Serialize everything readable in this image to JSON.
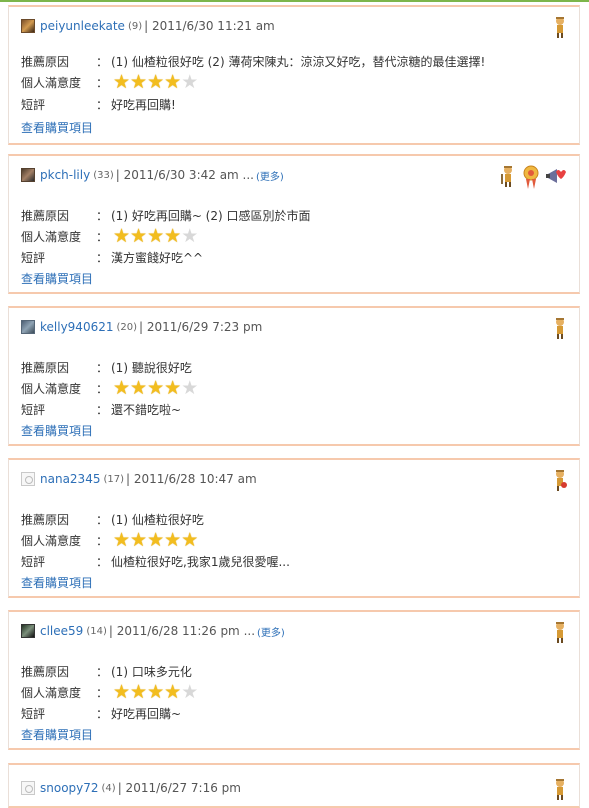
{
  "labels": {
    "reason": "推薦原因",
    "satisfaction": "個人滿意度",
    "comment": "短評",
    "colon": "："
  },
  "reviews": [
    {
      "user": "peiyunleekate",
      "count": "(9)",
      "date": "| 2011/6/30  11:21 am",
      "more": "",
      "reason": "(1) 仙楂粒很好吃  (2) 薄荷宋陳丸：涼涼又好吃，替代涼糖的最佳選擇!",
      "rating": 4,
      "comment": "好吃再回購!",
      "link": "查看購買項目",
      "avatar": "photo-avatar-icon",
      "medals": [
        "explorer-medal-icon"
      ]
    },
    {
      "user": "pkch-lily",
      "count": "(33)",
      "date": "| 2011/6/30  3:42 am ...",
      "more": "(更多)",
      "reason": "(1) 好吃再回購~  (2) 口感區別於市面",
      "rating": 4,
      "comment": "漢方蜜餞好吃^^",
      "link": "查看購買項目",
      "avatar": "photo-avatar-icon",
      "medals": [
        "explorer-medal-icon",
        "ribbon-medal-icon",
        "megaphone-heart-icon"
      ]
    },
    {
      "user": "kelly940621",
      "count": "(20)",
      "date": "| 2011/6/29  7:23 pm",
      "more": "",
      "reason": "(1) 聽說很好吃",
      "rating": 4,
      "comment": "還不錯吃啦~",
      "link": "查看購買項目",
      "avatar": "photo-avatar-icon",
      "medals": [
        "explorer-medal-icon"
      ]
    },
    {
      "user": "nana2345",
      "count": "(17)",
      "date": "| 2011/6/28  10:47 am",
      "more": "",
      "reason": "(1) 仙楂粒很好吃",
      "rating": 5,
      "comment": "仙楂粒很好吃,我家1歲兒很愛喔...",
      "link": "查看購買項目",
      "avatar": "blank-avatar-icon",
      "medals": [
        "explorer-red-medal-icon"
      ]
    },
    {
      "user": "cllee59",
      "count": "(14)",
      "date": "| 2011/6/28  11:26 pm ...",
      "more": "(更多)",
      "reason": "(1) 口味多元化",
      "rating": 4,
      "comment": "好吃再回購~",
      "link": "查看購買項目",
      "avatar": "photo-avatar-icon",
      "medals": [
        "explorer-medal-icon"
      ]
    },
    {
      "user": "snoopy72",
      "count": "(4)",
      "date": "| 2011/6/27  7:16 pm",
      "more": "",
      "reason": "",
      "rating": 0,
      "comment": "",
      "link": "",
      "avatar": "blank-avatar-icon",
      "medals": [
        "explorer-medal-icon"
      ]
    }
  ],
  "colors": {
    "link": "#2d6fb7",
    "star_on": "#f2bd1f",
    "star_off": "#d8d8d8",
    "card_border": "#f6c9ad",
    "top_line": "#7db54b"
  }
}
